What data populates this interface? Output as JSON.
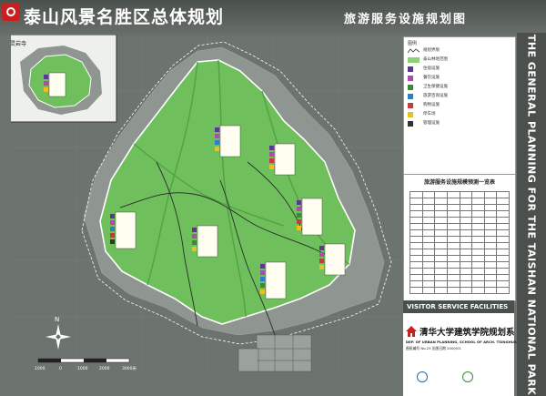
{
  "header": {
    "title": "泰山风景名胜区总体规划",
    "subtitle": "旅游服务设施规划图"
  },
  "side_title": "THE GENERAL PLANNING FOR THE TAISHAN NATIONAL PARK",
  "inset": {
    "label": "灵岩寺"
  },
  "legend": {
    "heading": "图例",
    "items": [
      {
        "label": "规划界限",
        "symbol": "boundary-line-icon"
      },
      {
        "label": "泰山林地范围",
        "symbol": "forest-area-icon",
        "color": "#8ed07a"
      },
      {
        "label": "住宿设施",
        "symbol": "lodging-icon",
        "color": "#5a3a8a"
      },
      {
        "label": "餐饮设施",
        "symbol": "dining-icon",
        "color": "#b04ab0"
      },
      {
        "label": "卫生保健设施",
        "symbol": "health-icon",
        "color": "#3a8a3a"
      },
      {
        "label": "旅游咨询设施",
        "symbol": "info-icon",
        "color": "#2a7fc8"
      },
      {
        "label": "购物设施",
        "symbol": "shopping-icon",
        "color": "#c83a3a"
      },
      {
        "label": "停车场",
        "symbol": "parking-icon",
        "color": "#e8c020"
      },
      {
        "label": "管理设施",
        "symbol": "management-icon",
        "color": "#333333"
      }
    ]
  },
  "table": {
    "title": "旅游服务设施规模预测一览表"
  },
  "map": {
    "north_label": "N",
    "scale_ticks": [
      "1000",
      "0",
      "1000",
      "2000",
      "3000米"
    ]
  },
  "footer": {
    "section_label": "VISITOR SERVICE FACILITIES",
    "institution": "清华大学建筑学院规划系",
    "institution_en": "DEP. OF URBAN PLANNING, SCHOOL OF ARCH. TSINGHUA UNIV.",
    "drawing_meta": "图纸编号 No.23   出图日期 2000/01"
  },
  "colors": {
    "forest": "#6fbf5c",
    "forest_dark": "#4f9e40",
    "terrain": "#8f9590",
    "roads": "#2b2b2b",
    "boundary": "#ffffff"
  }
}
